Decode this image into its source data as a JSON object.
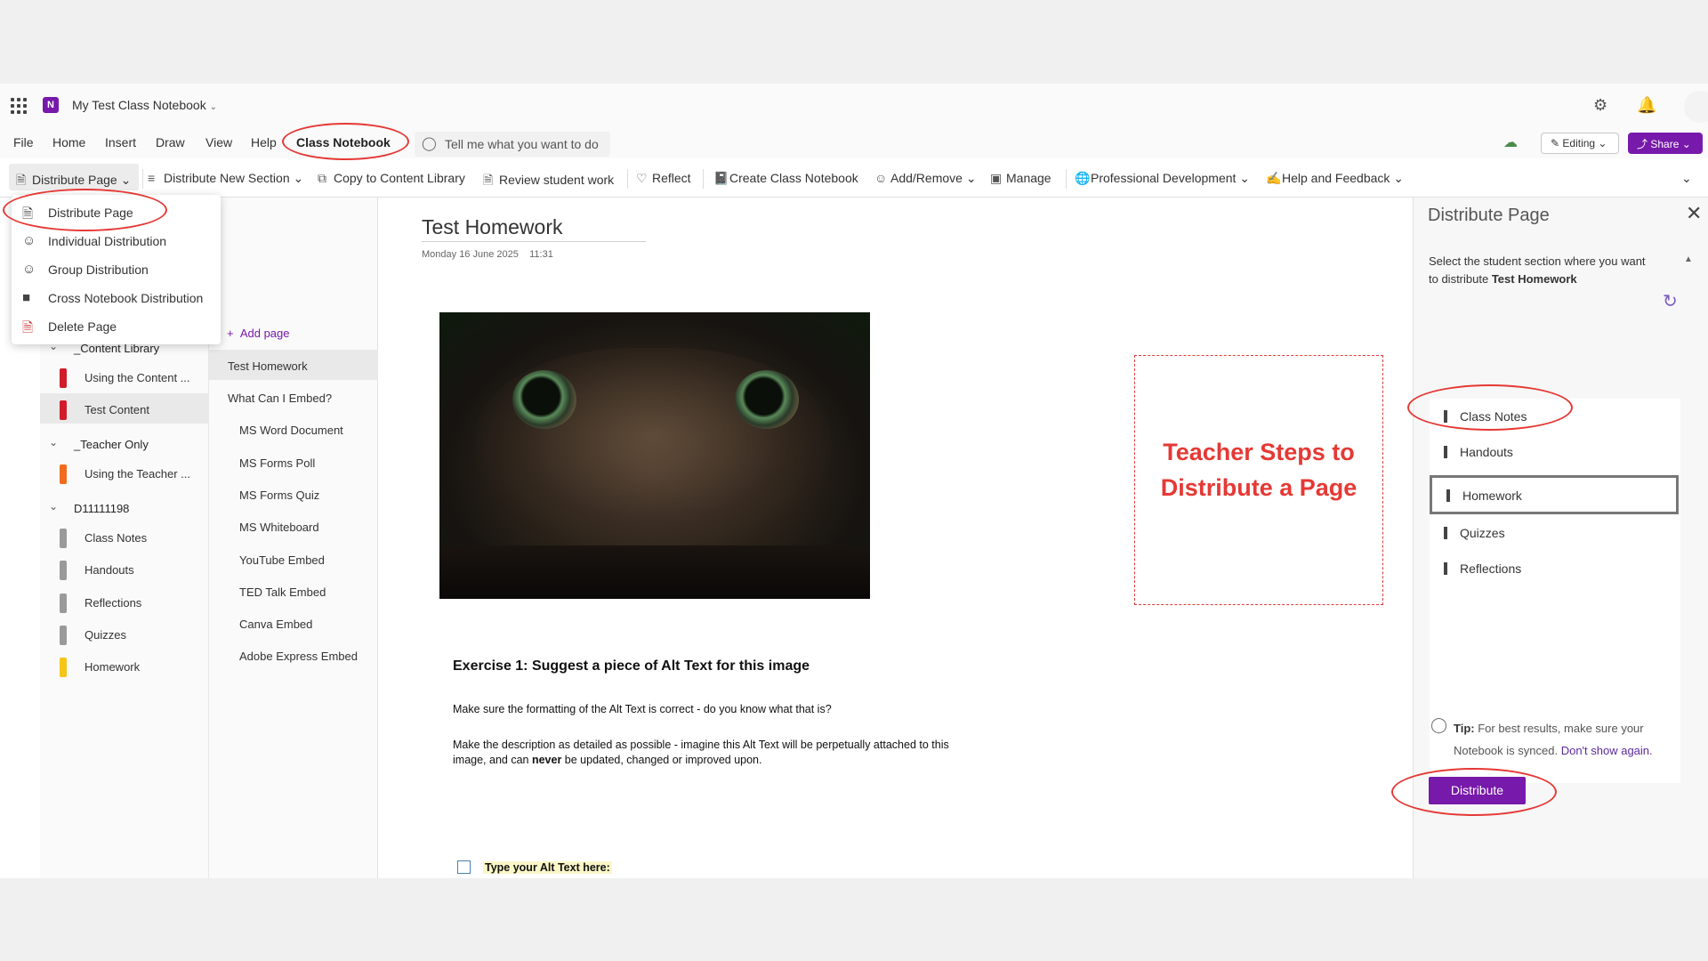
{
  "app": {
    "notebook_title": "My Test Class Notebook"
  },
  "menu": {
    "tabs": [
      "File",
      "Home",
      "Insert",
      "Draw",
      "View",
      "Help",
      "Class Notebook"
    ],
    "tell_me_placeholder": "Tell me what you want to do",
    "editing": "Editing",
    "share": "Share"
  },
  "ribbon": {
    "distribute_page": "Distribute Page",
    "distribute_new_section": "Distribute New Section",
    "copy_to_content_library": "Copy to Content Library",
    "review_student_work": "Review student work",
    "reflect": "Reflect",
    "create_class_notebook": "Create Class Notebook",
    "add_remove": "Add/Remove",
    "manage": "Manage",
    "professional_development": "Professional Development",
    "help_and_feedback": "Help and Feedback"
  },
  "dropdown": [
    "Distribute Page",
    "Individual Distribution",
    "Group Distribution",
    "Cross Notebook Distribution",
    "Delete Page"
  ],
  "sections": {
    "content_library": {
      "label": "_Content Library",
      "items": [
        "Using the Content ...",
        "Test Content"
      ]
    },
    "teacher_only": {
      "label": "_Teacher Only",
      "items": [
        "Using the Teacher ..."
      ]
    },
    "student": {
      "label": "D11111198",
      "items": [
        "Class Notes",
        "Handouts",
        "Reflections",
        "Quizzes",
        "Homework"
      ]
    }
  },
  "pages": {
    "add_page": "Add page",
    "items": [
      "Test Homework",
      "What Can I Embed?",
      "MS Word Document",
      "MS Forms Poll",
      "MS Forms Quiz",
      "MS Whiteboard",
      "YouTube Embed",
      "TED Talk Embed",
      "Canva Embed",
      "Adobe Express Embed"
    ]
  },
  "page": {
    "title": "Test Homework",
    "date": "Monday 16 June 2025",
    "time": "11:31",
    "teacher_note_line1": "Teacher Steps to",
    "teacher_note_line2": "Distribute a Page",
    "exercise_title": "Exercise 1: Suggest a piece of Alt Text for this image",
    "para1": "Make sure the formatting of the Alt Text is correct - do you know what that is?",
    "para2a": "Make the description as detailed as possible - imagine this Alt Text will be perpetually attached to this",
    "para2b_pre": "image, and can ",
    "para2b_bold": "never",
    "para2b_post": " be updated, changed or improved upon.",
    "checkbox_label": "Type your Alt Text here:"
  },
  "panel": {
    "title": "Distribute Page",
    "desc": "Select the student section where you want to distribute ",
    "desc_bold": "Test Homework",
    "sections": [
      "Class Notes",
      "Handouts",
      "Homework",
      "Quizzes",
      "Reflections"
    ],
    "tip_label": "Tip:",
    "tip_text": " For best results, make sure your Notebook is synced.",
    "tip_link": "Don't show again.",
    "distribute_button": "Distribute"
  },
  "colors": {
    "accent": "#7719aa",
    "annotation": "#e53935"
  }
}
